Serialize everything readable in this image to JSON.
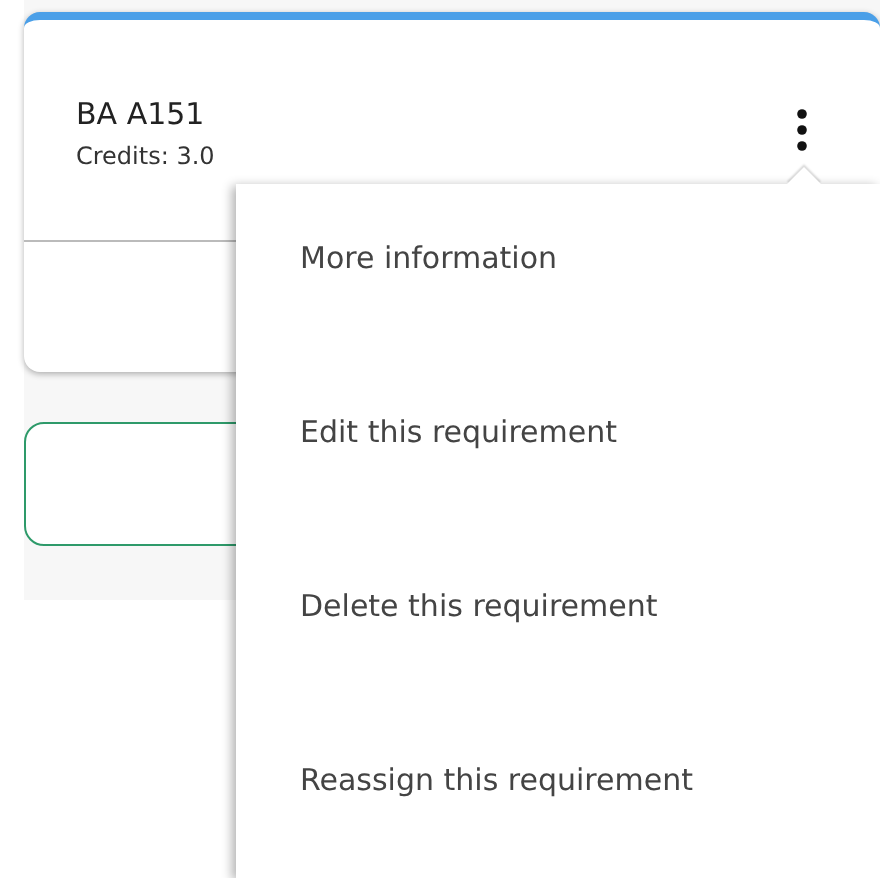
{
  "card": {
    "title": "BA A151",
    "credits": "Credits: 3.0"
  },
  "menu": {
    "items": [
      {
        "label": "More information"
      },
      {
        "label": "Edit this requirement"
      },
      {
        "label": "Delete this requirement"
      },
      {
        "label": "Reassign this requirement"
      }
    ]
  }
}
